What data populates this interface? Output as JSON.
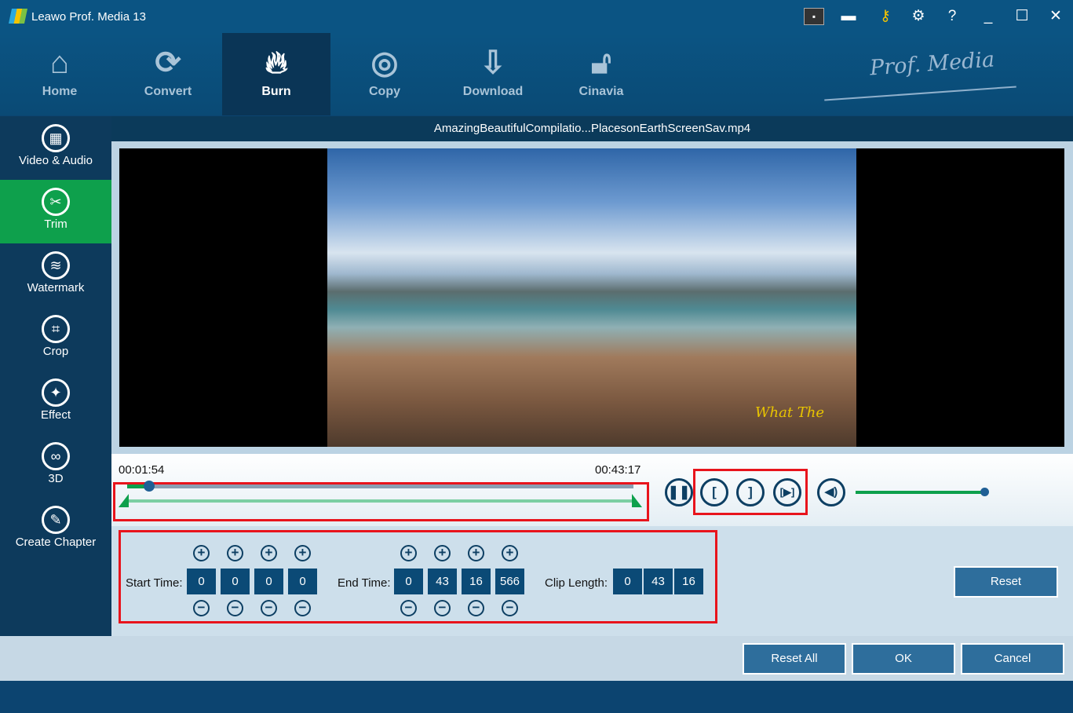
{
  "app": {
    "title": "Leawo Prof. Media 13",
    "brand": "Prof. Media"
  },
  "nav": [
    {
      "label": "Home",
      "icon": "home-icon"
    },
    {
      "label": "Convert",
      "icon": "convert-icon"
    },
    {
      "label": "Burn",
      "icon": "flame-icon"
    },
    {
      "label": "Copy",
      "icon": "disc-icon"
    },
    {
      "label": "Download",
      "icon": "download-icon"
    },
    {
      "label": "Cinavia",
      "icon": "unlock-icon"
    }
  ],
  "sidebar": [
    {
      "label": "Video & Audio"
    },
    {
      "label": "Trim"
    },
    {
      "label": "Watermark"
    },
    {
      "label": "Crop"
    },
    {
      "label": "Effect"
    },
    {
      "label": "3D"
    },
    {
      "label": "Create Chapter"
    }
  ],
  "file": {
    "name": "AmazingBeautifulCompilatio...PlacesonEarthScreenSav.mp4",
    "watermark": "What The"
  },
  "player": {
    "current_time": "00:01:54",
    "end_time": "00:43:17",
    "progress": 0.044,
    "volume": 1.0
  },
  "trim": {
    "start_label": "Start Time:",
    "start": [
      "0",
      "0",
      "0",
      "0"
    ],
    "end_label": "End Time:",
    "end": [
      "0",
      "43",
      "16",
      "566"
    ],
    "clip_label": "Clip Length:",
    "clip": [
      "0",
      "43",
      "16"
    ]
  },
  "buttons": {
    "reset": "Reset",
    "reset_all": "Reset All",
    "ok": "OK",
    "cancel": "Cancel"
  },
  "colors": {
    "accent": "#0ea04c",
    "primary": "#0b5483"
  }
}
